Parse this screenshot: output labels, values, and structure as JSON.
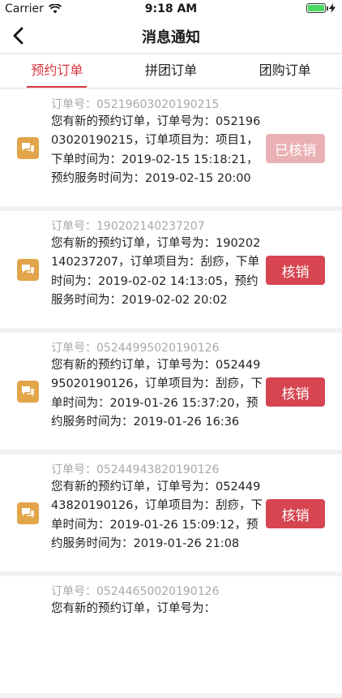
{
  "status_bar": {
    "carrier": "Carrier",
    "time": "9:18 AM"
  },
  "nav": {
    "title": "消息通知"
  },
  "tabs": [
    {
      "label": "预约订单",
      "active": true
    },
    {
      "label": "拼团订单",
      "active": false
    },
    {
      "label": "团购订单",
      "active": false
    }
  ],
  "colors": {
    "accent": "#d9363e",
    "icon_bg": "#e2a54a",
    "button": "#d64550",
    "button_done": "#eab1b4"
  },
  "cards": [
    {
      "order_no": "订单号：05219603020190215",
      "message": "您有新的预约订单，订单号为：05219603020190215，订单项目为：项目1，下单时间为：2019-02-15 15:18:21，预约服务时间为：2019-02-15 20:00",
      "button": "已核销",
      "done": true
    },
    {
      "order_no": "订单号：190202140237207",
      "message": "您有新的预约订单，订单号为：190202140237207，订单项目为：刮痧，下单时间为：2019-02-02 14:13:05，预约服务时间为：2019-02-02 20:02",
      "button": "核销",
      "done": false
    },
    {
      "order_no": "订单号：05244995020190126",
      "message": "您有新的预约订单，订单号为：05244995020190126，订单项目为：刮痧，下单时间为：2019-01-26 15:37:20，预约服务时间为：2019-01-26 16:36",
      "button": "核销",
      "done": false
    },
    {
      "order_no": "订单号：05244943820190126",
      "message": "您有新的预约订单，订单号为：05244943820190126，订单项目为：刮痧，下单时间为：2019-01-26 15:09:12，预约服务时间为：2019-01-26 21:08",
      "button": "核销",
      "done": false
    },
    {
      "order_no": "订单号：05244650020190126",
      "message": "您有新的预约订单，订单号为：",
      "button": "",
      "done": false
    }
  ]
}
